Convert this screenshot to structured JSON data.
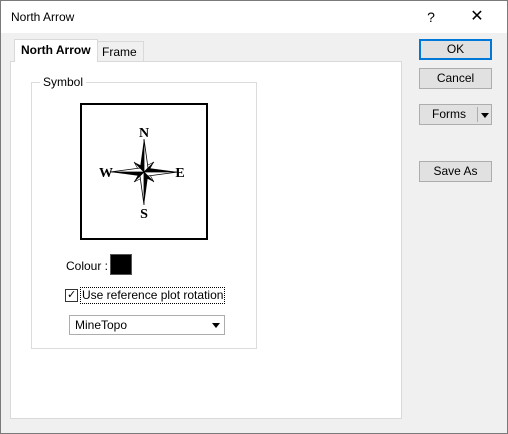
{
  "window": {
    "title": "North Arrow",
    "help_label": "?",
    "close_label": "✕"
  },
  "tabs": [
    {
      "label": "North Arrow",
      "active": true
    },
    {
      "label": "Frame",
      "active": false
    }
  ],
  "symbol_group": {
    "label": "Symbol",
    "compass": {
      "icon": "compass-rose-icon",
      "north": "N",
      "south": "S",
      "east": "E",
      "west": "W"
    },
    "colour_label": "Colour :",
    "colour_value": "#000000",
    "use_reference_rotation": {
      "label": "Use reference plot rotation",
      "checked": true,
      "check_glyph": "✓"
    },
    "projection_select": {
      "value": "MineTopo"
    }
  },
  "buttons": {
    "ok": "OK",
    "cancel": "Cancel",
    "forms": "Forms",
    "save_as": "Save As"
  }
}
